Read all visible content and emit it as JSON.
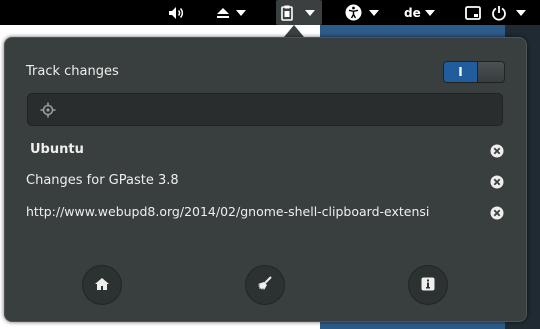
{
  "topbar": {
    "language": "de"
  },
  "menu": {
    "track_changes_label": "Track changes",
    "toggle_label": "I",
    "search": {
      "placeholder": "",
      "value": ""
    },
    "history": [
      {
        "label": "Ubuntu",
        "bold": true
      },
      {
        "label": "Changes for GPaste 3.8",
        "bold": false
      },
      {
        "label": "http://www.webupd8.org/2014/02/gnome-shell-clipboard-extensi",
        "bold": false
      }
    ]
  },
  "colors": {
    "accent": "#215d9c",
    "menu_bg": "#393f3f",
    "topbar_bg": "#000000"
  },
  "icons": {
    "volume": "volume-icon",
    "eject": "eject-icon",
    "clipboard": "clipboard-icon",
    "accessibility": "accessibility-icon",
    "window": "window-icon",
    "power": "power-icon",
    "search": "search-icon",
    "home": "home-icon",
    "clear": "broom-icon",
    "info": "info-icon"
  }
}
